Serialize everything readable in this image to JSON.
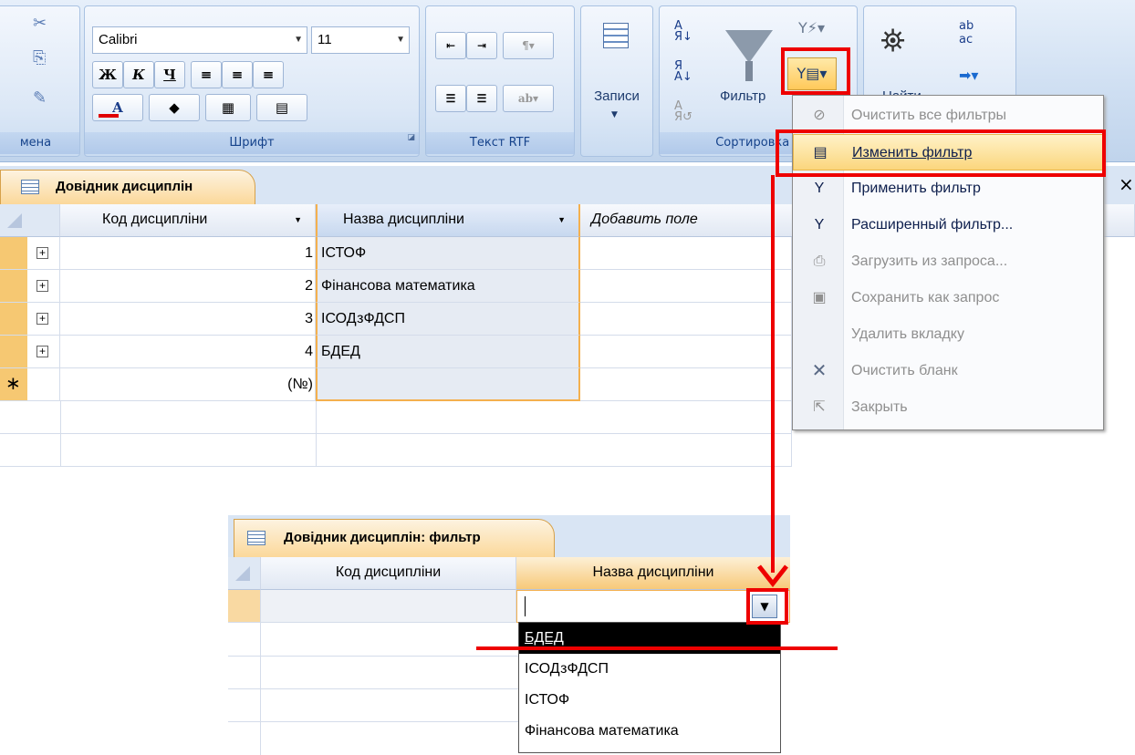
{
  "ribbon": {
    "font_name": "Calibri",
    "font_size": "11",
    "bold": "Ж",
    "italic": "К",
    "underline": "Ч",
    "group_clipboard": "мена",
    "group_font": "Шрифт",
    "group_rtf": "Текст RTF",
    "records": "Записи",
    "filter": "Фильтр",
    "group_sort": "Сортировка и",
    "find": "Найти"
  },
  "table_tab": "Довідник дисциплін",
  "table": {
    "columns": [
      "Код дисципліни",
      "Назва дисципліни",
      "Добавить поле"
    ],
    "rows": [
      {
        "code": "1",
        "name": "ІСТОФ"
      },
      {
        "code": "2",
        "name": "Фінансова математика"
      },
      {
        "code": "3",
        "name": "ІСОДзФДСП"
      },
      {
        "code": "4",
        "name": "БДЕД"
      }
    ],
    "new_row_code": "(№)"
  },
  "menu": {
    "items": [
      {
        "label": "Очистить все фильтры",
        "enabled": false,
        "icon": "clear-filters-icon"
      },
      {
        "label": "Изменить фильтр",
        "enabled": true,
        "icon": "filter-form-icon"
      },
      {
        "label": "Применить фильтр",
        "enabled": true,
        "icon": "apply-filter-icon"
      },
      {
        "label": "Расширенный фильтр...",
        "enabled": true,
        "icon": "advanced-filter-icon"
      },
      {
        "label": "Загрузить из запроса...",
        "enabled": false,
        "icon": "load-query-icon"
      },
      {
        "label": "Сохранить как запрос",
        "enabled": false,
        "icon": "save-query-icon"
      },
      {
        "label": "Удалить вкладку",
        "enabled": false,
        "icon": ""
      },
      {
        "label": "Очистить бланк",
        "enabled": false,
        "icon": "close-x-icon"
      },
      {
        "label": "Закрыть",
        "enabled": false,
        "icon": "close-form-icon"
      }
    ]
  },
  "filter_tab": "Довідник дисциплін: фильтр",
  "filter_table": {
    "columns": [
      "Код дисципліни",
      "Назва дисципліни"
    ]
  },
  "dropdown": {
    "options": [
      "БДЕД",
      "ІСОДзФДСП",
      "ІСТОФ",
      "Фінансова математика"
    ],
    "selected": "БДЕД"
  },
  "colors": {
    "accent_red": "#ee0000",
    "selection_orange": "#fbd9a0",
    "highlight": "#fbdc8e"
  }
}
